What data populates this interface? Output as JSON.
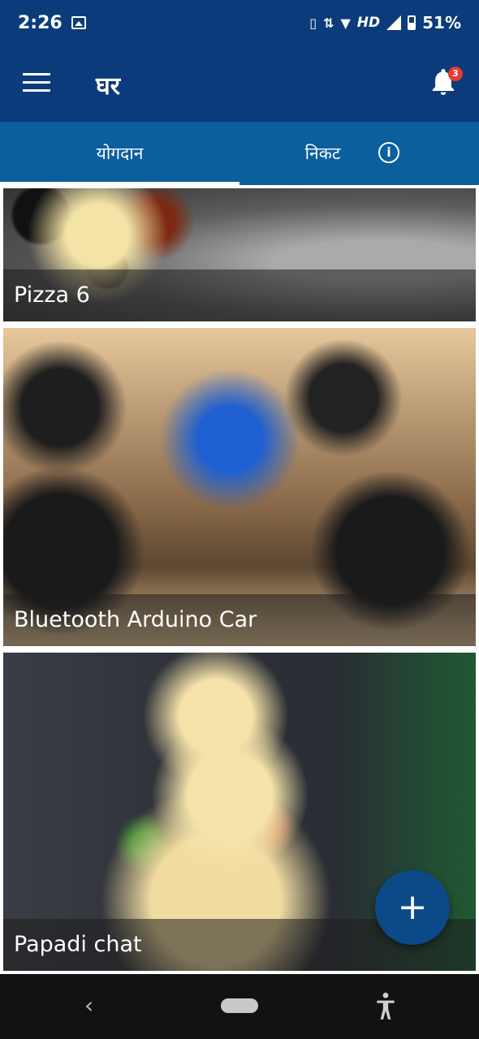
{
  "status_bar": {
    "time": "2:26",
    "network": "HD",
    "battery": "51%",
    "icons": [
      "image-icon",
      "vibrate-icon",
      "data-icon",
      "wifi-icon",
      "signal-icon",
      "battery-icon"
    ]
  },
  "app_bar": {
    "title": "घर",
    "notification_count": "3",
    "colors": {
      "background": "#0b3b7a",
      "badge": "#e53935"
    }
  },
  "tabs": {
    "items": [
      {
        "label": "योगदान",
        "selected": true
      },
      {
        "label": "निकट",
        "selected": false
      }
    ],
    "info_icon": "info-icon",
    "colors": {
      "background": "#0a5f9c",
      "indicator": "#ffffff"
    }
  },
  "feed": {
    "items": [
      {
        "title": "Pizza 6"
      },
      {
        "title": "Bluetooth Arduino Car"
      },
      {
        "title": "Papadi chat"
      }
    ]
  },
  "fab": {
    "label": "+"
  },
  "nav_bar": {
    "icons": [
      "back-icon",
      "home-pill-icon",
      "accessibility-icon"
    ]
  }
}
